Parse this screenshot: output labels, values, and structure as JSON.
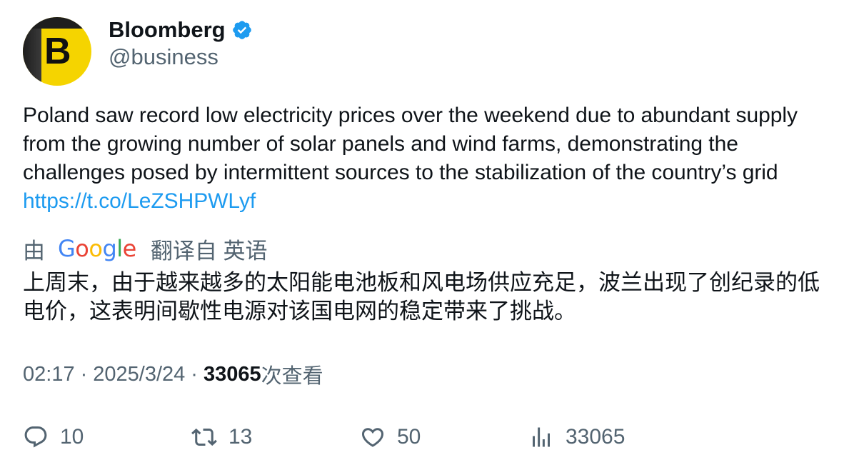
{
  "author": {
    "name": "Bloomberg",
    "handle": "@business",
    "avatar_letter": "B",
    "verified_icon": "verified-badge-icon"
  },
  "tweet": {
    "text": "Poland saw record low electricity prices over the weekend due to abundant supply from the growing number of solar panels and wind farms, demonstrating the challenges posed by intermittent sources to the stabilization of the country’s grid ",
    "link": "https://t.co/LeZSHPWLyf"
  },
  "translation": {
    "prefix": "由",
    "provider": "Google",
    "suffix": "翻译自 英语",
    "text": "上周末，由于越来越多的太阳能电池板和风电场供应充足，波兰出现了创纪录的低电价，这表明间歇性电源对该国电网的稳定带来了挑战。"
  },
  "meta": {
    "time": "02:17",
    "date": "2025/3/24",
    "views_count": "33065",
    "views_label": "次查看"
  },
  "actions": {
    "replies": "10",
    "retweets": "13",
    "likes": "50",
    "views": "33065"
  },
  "colors": {
    "text": "#0f1419",
    "secondary": "#536471",
    "link": "#1d9bf0",
    "avatar_yellow": "#f5d400"
  }
}
